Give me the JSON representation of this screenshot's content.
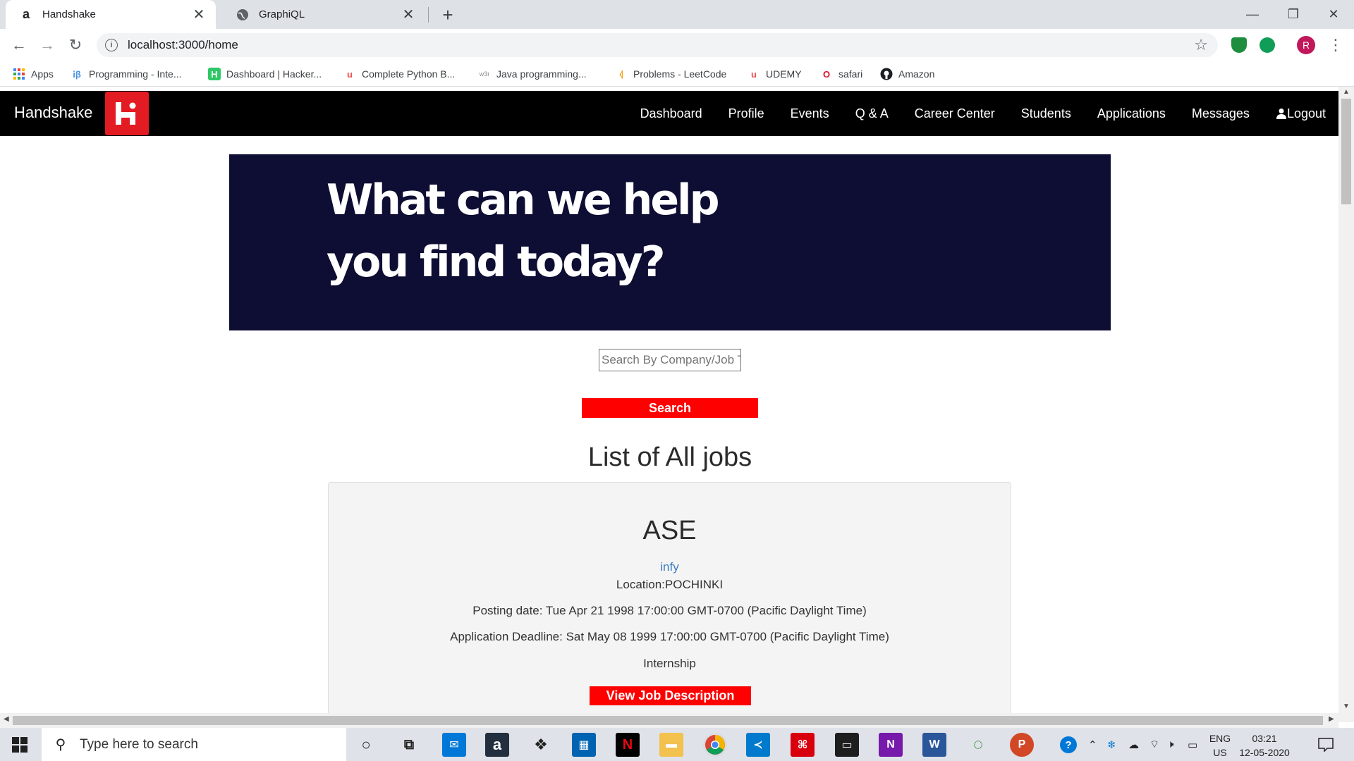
{
  "browser": {
    "tabs": [
      {
        "title": "Handshake",
        "favicon": "amazon-a-icon"
      },
      {
        "title": "GraphiQL",
        "favicon": "globe-icon"
      }
    ],
    "url": "localhost:3000/home",
    "profile_initial": "R",
    "bookmarks": [
      {
        "label": "Apps",
        "icon": "apps-grid-icon"
      },
      {
        "label": "Programming - Inte...",
        "icon": "ib-icon"
      },
      {
        "label": "Dashboard | Hacker...",
        "icon": "hackerrank-icon"
      },
      {
        "label": "Complete Python B...",
        "icon": "udemy-icon"
      },
      {
        "label": "Java programming...",
        "icon": "w3r-icon"
      },
      {
        "label": "Problems - LeetCode",
        "icon": "leetcode-icon"
      },
      {
        "label": "UDEMY",
        "icon": "udemy-icon"
      },
      {
        "label": "safari",
        "icon": "opera-icon"
      },
      {
        "label": "Amazon",
        "icon": "github-icon"
      }
    ]
  },
  "app": {
    "brand": "Handshake",
    "nav": [
      "Dashboard",
      "Profile",
      "Events",
      "Q & A",
      "Career Center",
      "Students",
      "Applications",
      "Messages",
      "Logout"
    ],
    "hero": {
      "line1": "What can we help",
      "line2": "you find today?"
    },
    "search": {
      "placeholder": "Search By Company/Job Title",
      "button": "Search"
    },
    "list_heading": "List of All jobs",
    "jobs": [
      {
        "title": "ASE",
        "company": "infy",
        "location": "Location:POCHINKI",
        "posting_date": "Posting date: Tue Apr 21 1998 17:00:00 GMT-0700 (Pacific Daylight Time)",
        "deadline": "Application Deadline: Sat May 08 1999 17:00:00 GMT-0700 (Pacific Daylight Time)",
        "category": "Internship",
        "button": "View Job Description"
      }
    ]
  },
  "taskbar": {
    "search_placeholder": "Type here to search",
    "lang_line1": "ENG",
    "lang_line2": "US",
    "time": "03:21",
    "date": "12-05-2020"
  },
  "colors": {
    "accent": "#ff0000",
    "navbar": "#000000",
    "hero_bg": "#0e0d33",
    "link": "#3b7bbf"
  }
}
